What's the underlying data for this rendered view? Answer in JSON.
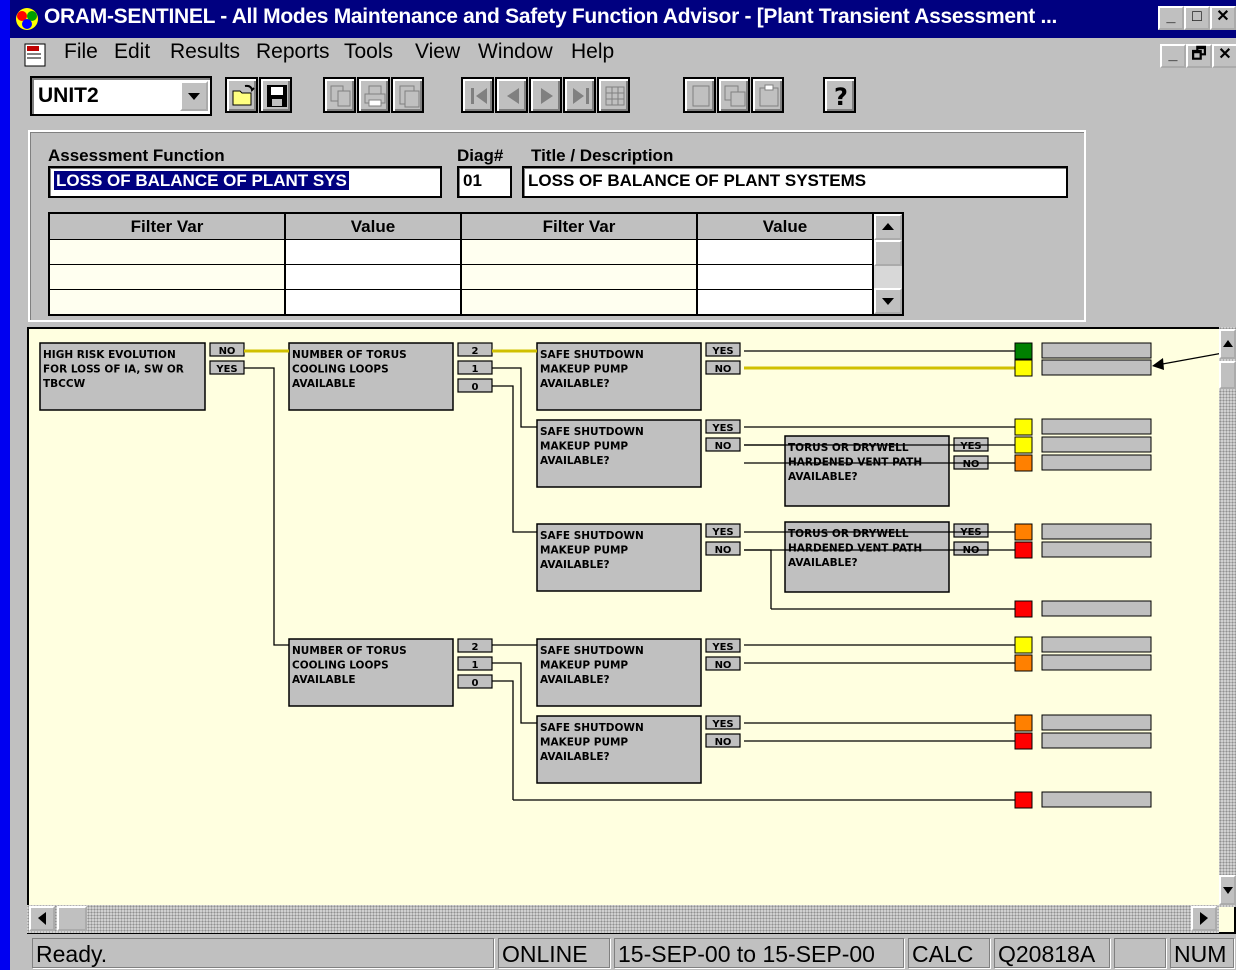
{
  "window": {
    "title": "ORAM-SENTINEL - All Modes Maintenance and Safety Function Advisor - [Plant Transient Assessment ...",
    "controls": [
      "_",
      "□",
      "✕"
    ],
    "mdi_controls": [
      "_",
      "🗗",
      "✕"
    ]
  },
  "menu": [
    "File",
    "Edit",
    "Results",
    "Reports",
    "Tools",
    "View",
    "Window",
    "Help"
  ],
  "toolbar": {
    "unit_value": "UNIT2",
    "buttons": [
      "open-icon",
      "save-icon",
      "copy-icon",
      "print-icon",
      "preview-icon",
      "first-icon",
      "prev-icon",
      "next-icon",
      "last-icon",
      "grid-icon",
      "new-icon",
      "duplicate-icon",
      "clipboard-icon",
      "help-icon"
    ]
  },
  "header": {
    "assessment_label": "Assessment Function",
    "assessment_value": "LOSS OF BALANCE OF PLANT SYS",
    "diag_label": "Diag#",
    "diag_value": "01",
    "title_label": "Title / Description",
    "title_value": "LOSS OF BALANCE OF PLANT SYSTEMS",
    "filter_columns": [
      "Filter Var",
      "Value",
      "Filter Var",
      "Value"
    ]
  },
  "tree": {
    "nodes": [
      {
        "id": "n1",
        "text": [
          "HIGH RISK EVOLUTION",
          "FOR LOSS OF IA, SW OR",
          "TBCCW"
        ]
      },
      {
        "id": "n2",
        "text": [
          "NUMBER OF TORUS",
          "COOLING LOOPS",
          "AVAILABLE"
        ]
      },
      {
        "id": "n3",
        "text": [
          "NUMBER OF TORUS",
          "COOLING LOOPS",
          "AVAILABLE"
        ]
      },
      {
        "id": "n4",
        "text": [
          "SAFE SHUTDOWN",
          "MAKEUP PUMP",
          "AVAILABLE?"
        ]
      },
      {
        "id": "n5",
        "text": [
          "SAFE SHUTDOWN",
          "MAKEUP PUMP",
          "AVAILABLE?"
        ]
      },
      {
        "id": "n6",
        "text": [
          "SAFE SHUTDOWN",
          "MAKEUP PUMP",
          "AVAILABLE?"
        ]
      },
      {
        "id": "n7",
        "text": [
          "TORUS OR DRYWELL",
          "HARDENED VENT PATH",
          "AVAILABLE?"
        ]
      },
      {
        "id": "n8",
        "text": [
          "TORUS OR DRYWELL",
          "HARDENED VENT PATH",
          "AVAILABLE?"
        ]
      },
      {
        "id": "n9",
        "text": [
          "SAFE SHUTDOWN",
          "MAKEUP PUMP",
          "AVAILABLE?"
        ]
      },
      {
        "id": "n10",
        "text": [
          "SAFE SHUTDOWN",
          "MAKEUP PUMP",
          "AVAILABLE?"
        ]
      }
    ],
    "tags": {
      "no": "NO",
      "yes": "YES",
      "two": "2",
      "one": "1",
      "zero": "0"
    },
    "outcomes": [
      "green",
      "yellow",
      "yellow",
      "yellow",
      "orange",
      "orange",
      "red",
      "red",
      "yellow",
      "orange",
      "orange",
      "red",
      "red"
    ],
    "colors": {
      "green": "#008000",
      "yellow": "#ffff00",
      "orange": "#ff8000",
      "red": "#ff0000"
    }
  },
  "status": {
    "ready": "Ready.",
    "online": "ONLINE",
    "range": "15-SEP-00 to 15-SEP-00",
    "calc": "CALC",
    "code": "Q20818A",
    "blank": "",
    "num": "NUM"
  }
}
